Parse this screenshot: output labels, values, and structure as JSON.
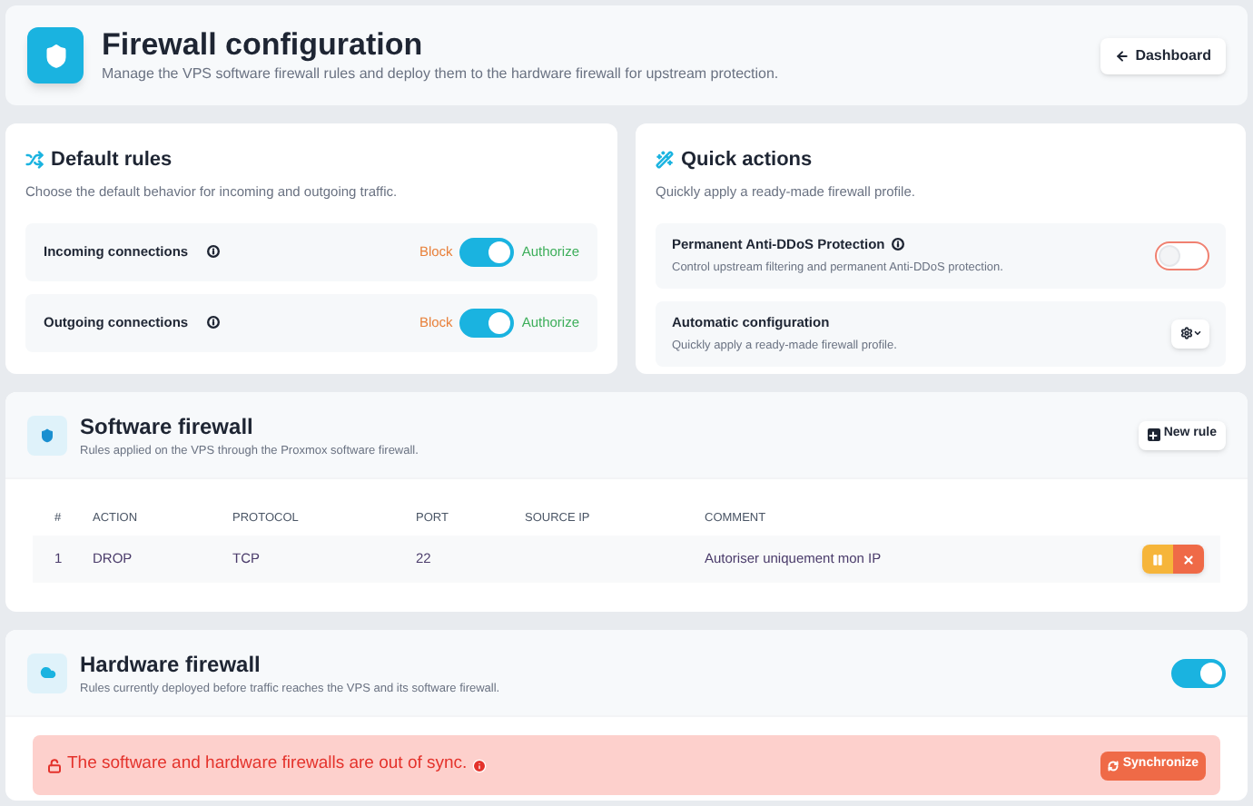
{
  "header": {
    "title": "Firewall configuration",
    "subtitle": "Manage the VPS software firewall rules and deploy them to the hardware firewall for upstream protection.",
    "button": "Dashboard"
  },
  "default_rules": {
    "title": "Default rules",
    "subtitle": "Choose the default behavior for incoming and outgoing traffic.",
    "rows": [
      {
        "label": "Incoming connections",
        "off_label": "Block",
        "on_label": "Authorize",
        "on": true
      },
      {
        "label": "Outgoing connections",
        "off_label": "Block",
        "on_label": "Authorize",
        "on": true
      }
    ]
  },
  "quick_actions": {
    "title": "Quick actions",
    "subtitle": "Quickly apply a ready-made firewall profile.",
    "items": [
      {
        "kind": "toggle",
        "title": "Permanent Anti-DDoS Protection",
        "description": "Control upstream filtering and permanent Anti-DDoS protection.",
        "on": false
      },
      {
        "kind": "menu",
        "title": "Automatic configuration",
        "description": "Quickly apply a ready-made firewall profile."
      }
    ]
  },
  "software_firewall": {
    "title": "Software firewall",
    "subtitle": "Rules applied on the VPS through the Proxmox software firewall.",
    "button": "New rule",
    "table": {
      "columns": [
        "#",
        "ACTION",
        "PROTOCOL",
        "PORT",
        "SOURCE IP",
        "COMMENT"
      ],
      "rows": [
        {
          "cells": [
            "1",
            "DROP",
            "TCP",
            "22",
            "",
            "Autoriser uniquement mon IP"
          ]
        }
      ]
    }
  },
  "hardware_firewall": {
    "title": "Hardware firewall",
    "subtitle": "Rules currently deployed before traffic reaches the VPS and its software firewall.",
    "on": true,
    "alert": {
      "text": "The software and hardware firewalls are out of sync.",
      "button": "Synchronize"
    }
  }
}
